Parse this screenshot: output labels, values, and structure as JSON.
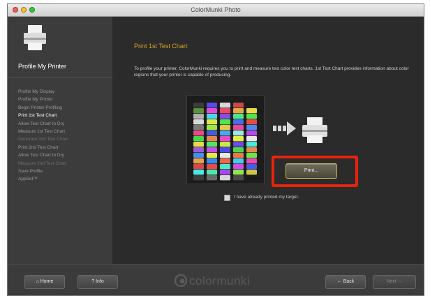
{
  "window": {
    "title": "ColorMunki Photo"
  },
  "sidebar": {
    "title": "Profile My Printer",
    "steps": [
      {
        "label": "Profile My Display"
      },
      {
        "label": "Profile My Printer"
      },
      {
        "label": "Begin Printer Profiling"
      },
      {
        "label": "Print 1st Test Chart",
        "state": "active"
      },
      {
        "label": "Allow Test Chart to Dry"
      },
      {
        "label": "Measure 1st Test Chart"
      },
      {
        "label": "Generate 2nd Test Chart",
        "state": "dim"
      },
      {
        "label": "Print 2nd Test Chart"
      },
      {
        "label": "Allow Test Chart to Dry"
      },
      {
        "label": "Measure 2nd Test Chart",
        "state": "dim"
      },
      {
        "label": "Save Profile"
      },
      {
        "label": "AppSet™"
      }
    ]
  },
  "main": {
    "heading": "Print 1st Test Chart",
    "description": "To profile your printer, ColorMunki requires you to print and measure two color test charts. 1st Test Chart provides information about color regions that your printer is capable of producing.",
    "print_button_label": "Print...",
    "printed_checkbox_label": "I have already printed my target.",
    "printed_checkbox_checked": false
  },
  "chart_columns": [
    [
      "#3b3b3b",
      "#5e8f3b",
      "#b0b0b0",
      "#d9d9d9",
      "#7a7a7a",
      "#e84a8a",
      "#45d64a",
      "#e8d84a",
      "#9a5cd8",
      "#4a8ee8",
      "#e8a04a",
      "#d84a4a",
      "#4ae8e8",
      "#3c3c3c"
    ],
    [
      "#5a4ae8",
      "#e84ad8",
      "#4ad8e8",
      "#d8e84a",
      "#9ae84a",
      "#4a5ad8",
      "#e8864a",
      "#4ae86a",
      "#c84ae8",
      "#e8e84a",
      "#3a8ae8",
      "#e84a4a",
      "#4ae8b0",
      "#6a6a6a"
    ],
    [
      "#d8d8d8",
      "#e84a6a",
      "#8a4ae8",
      "#4ae84a",
      "#e8c84a",
      "#4aa8e8",
      "#e84ac8",
      "#c8e84a",
      "#4a4ae8",
      "#e8e8e8",
      "#e86a4a",
      "#4ae8c8",
      "#a84ae8",
      "#d8d8d8"
    ],
    [
      "#c84a4a",
      "#e8a84a",
      "#4ae88a",
      "#4a6ae8",
      "#e84a9a",
      "#9ae8e8",
      "#e8e84a",
      "#6a4ae8",
      "#4ad84a",
      "#e87a4a",
      "#4ac8e8",
      "#d84ae8",
      "#8ae84a",
      "#4a4a4a"
    ],
    [
      "#1a1a1a",
      "#e8d84a",
      "#4ae84a",
      "#e84a4a",
      "#4a8ae8",
      "#b84ae8",
      "#e8e8e8",
      "#4ae8d8",
      "#e8884a",
      "#6ae84a",
      "#e84ab8",
      "#4a5ae8",
      "#c8c84a",
      "#1a1a1a"
    ]
  ],
  "bottombar": {
    "home_label": "Home",
    "info_label": "Info",
    "logo_text": "colormunki",
    "back_label": "Back",
    "next_label": "Next"
  },
  "colors": {
    "accent_heading": "#d9a421",
    "highlight": "#e8230c"
  }
}
